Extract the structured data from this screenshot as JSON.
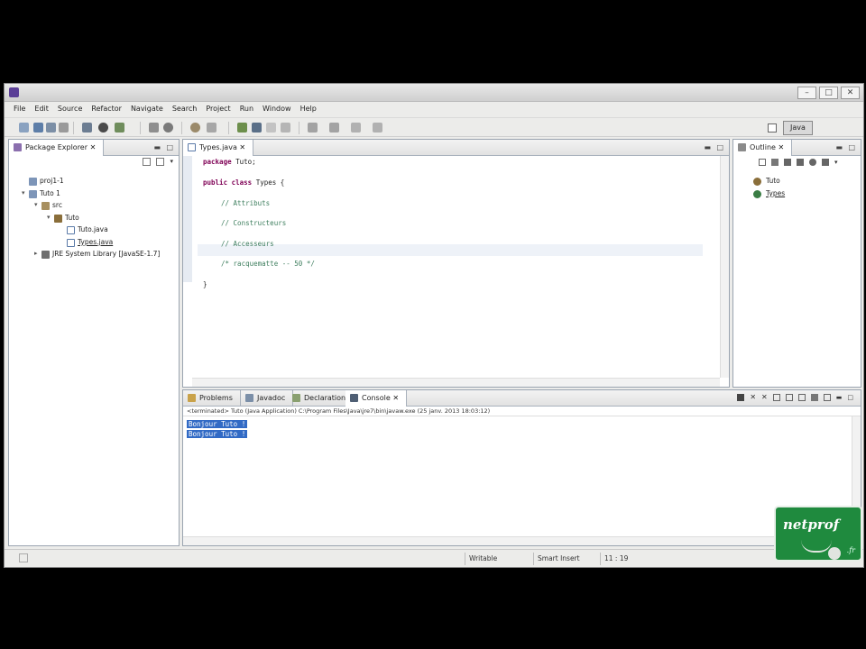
{
  "menu": [
    "File",
    "Edit",
    "Source",
    "Refactor",
    "Navigate",
    "Search",
    "Project",
    "Run",
    "Window",
    "Help"
  ],
  "perspective": {
    "label": "Java"
  },
  "package_explorer": {
    "tab_label": "Package Explorer",
    "tree": [
      {
        "label": "proj1-1",
        "depth": 0,
        "icon": "project-icon"
      },
      {
        "label": "Tuto 1",
        "depth": 0,
        "icon": "project-icon"
      },
      {
        "label": "src",
        "depth": 1,
        "icon": "source-folder-icon"
      },
      {
        "label": "Tuto",
        "depth": 2,
        "icon": "package-icon"
      },
      {
        "label": "Tuto.java",
        "depth": 3,
        "icon": "java-file-icon"
      },
      {
        "label": "Types.java",
        "depth": 3,
        "icon": "java-file-icon"
      },
      {
        "label": "JRE System Library [JavaSE-1.7]",
        "depth": 1,
        "icon": "library-icon"
      }
    ]
  },
  "editor": {
    "tab_label": "Types.java",
    "lines": [
      {
        "kw": "package",
        "text": " Tuto;"
      },
      {
        "kw": "public class",
        "text": " Types {"
      },
      {
        "comment": "// Attributs"
      },
      {
        "comment": "// Constructeurs"
      },
      {
        "comment": "// Accesseurs"
      },
      {
        "comment": "/* racquematte -- 50 */"
      },
      {
        "text": "}"
      }
    ]
  },
  "outline": {
    "tab_label": "Outline",
    "items": [
      {
        "label": "Tuto",
        "icon": "package-icon"
      },
      {
        "label": "Types",
        "icon": "class-icon"
      }
    ]
  },
  "bottom_tabs": [
    "Problems",
    "Javadoc",
    "Declaration",
    "Console"
  ],
  "console": {
    "header": "<terminated> Tuto (Java Application) C:\\Program Files\\Java\\jre7\\bin\\javaw.exe (25 janv. 2013 18:03:12)",
    "output": [
      "Bonjour Tuto !",
      "Bonjour Tuto !"
    ]
  },
  "statusbar": {
    "writable": "Writable",
    "insert_mode": "Smart Insert",
    "position": "11 : 19"
  },
  "brand": {
    "name": "netprof",
    "suffix": ".fr"
  }
}
